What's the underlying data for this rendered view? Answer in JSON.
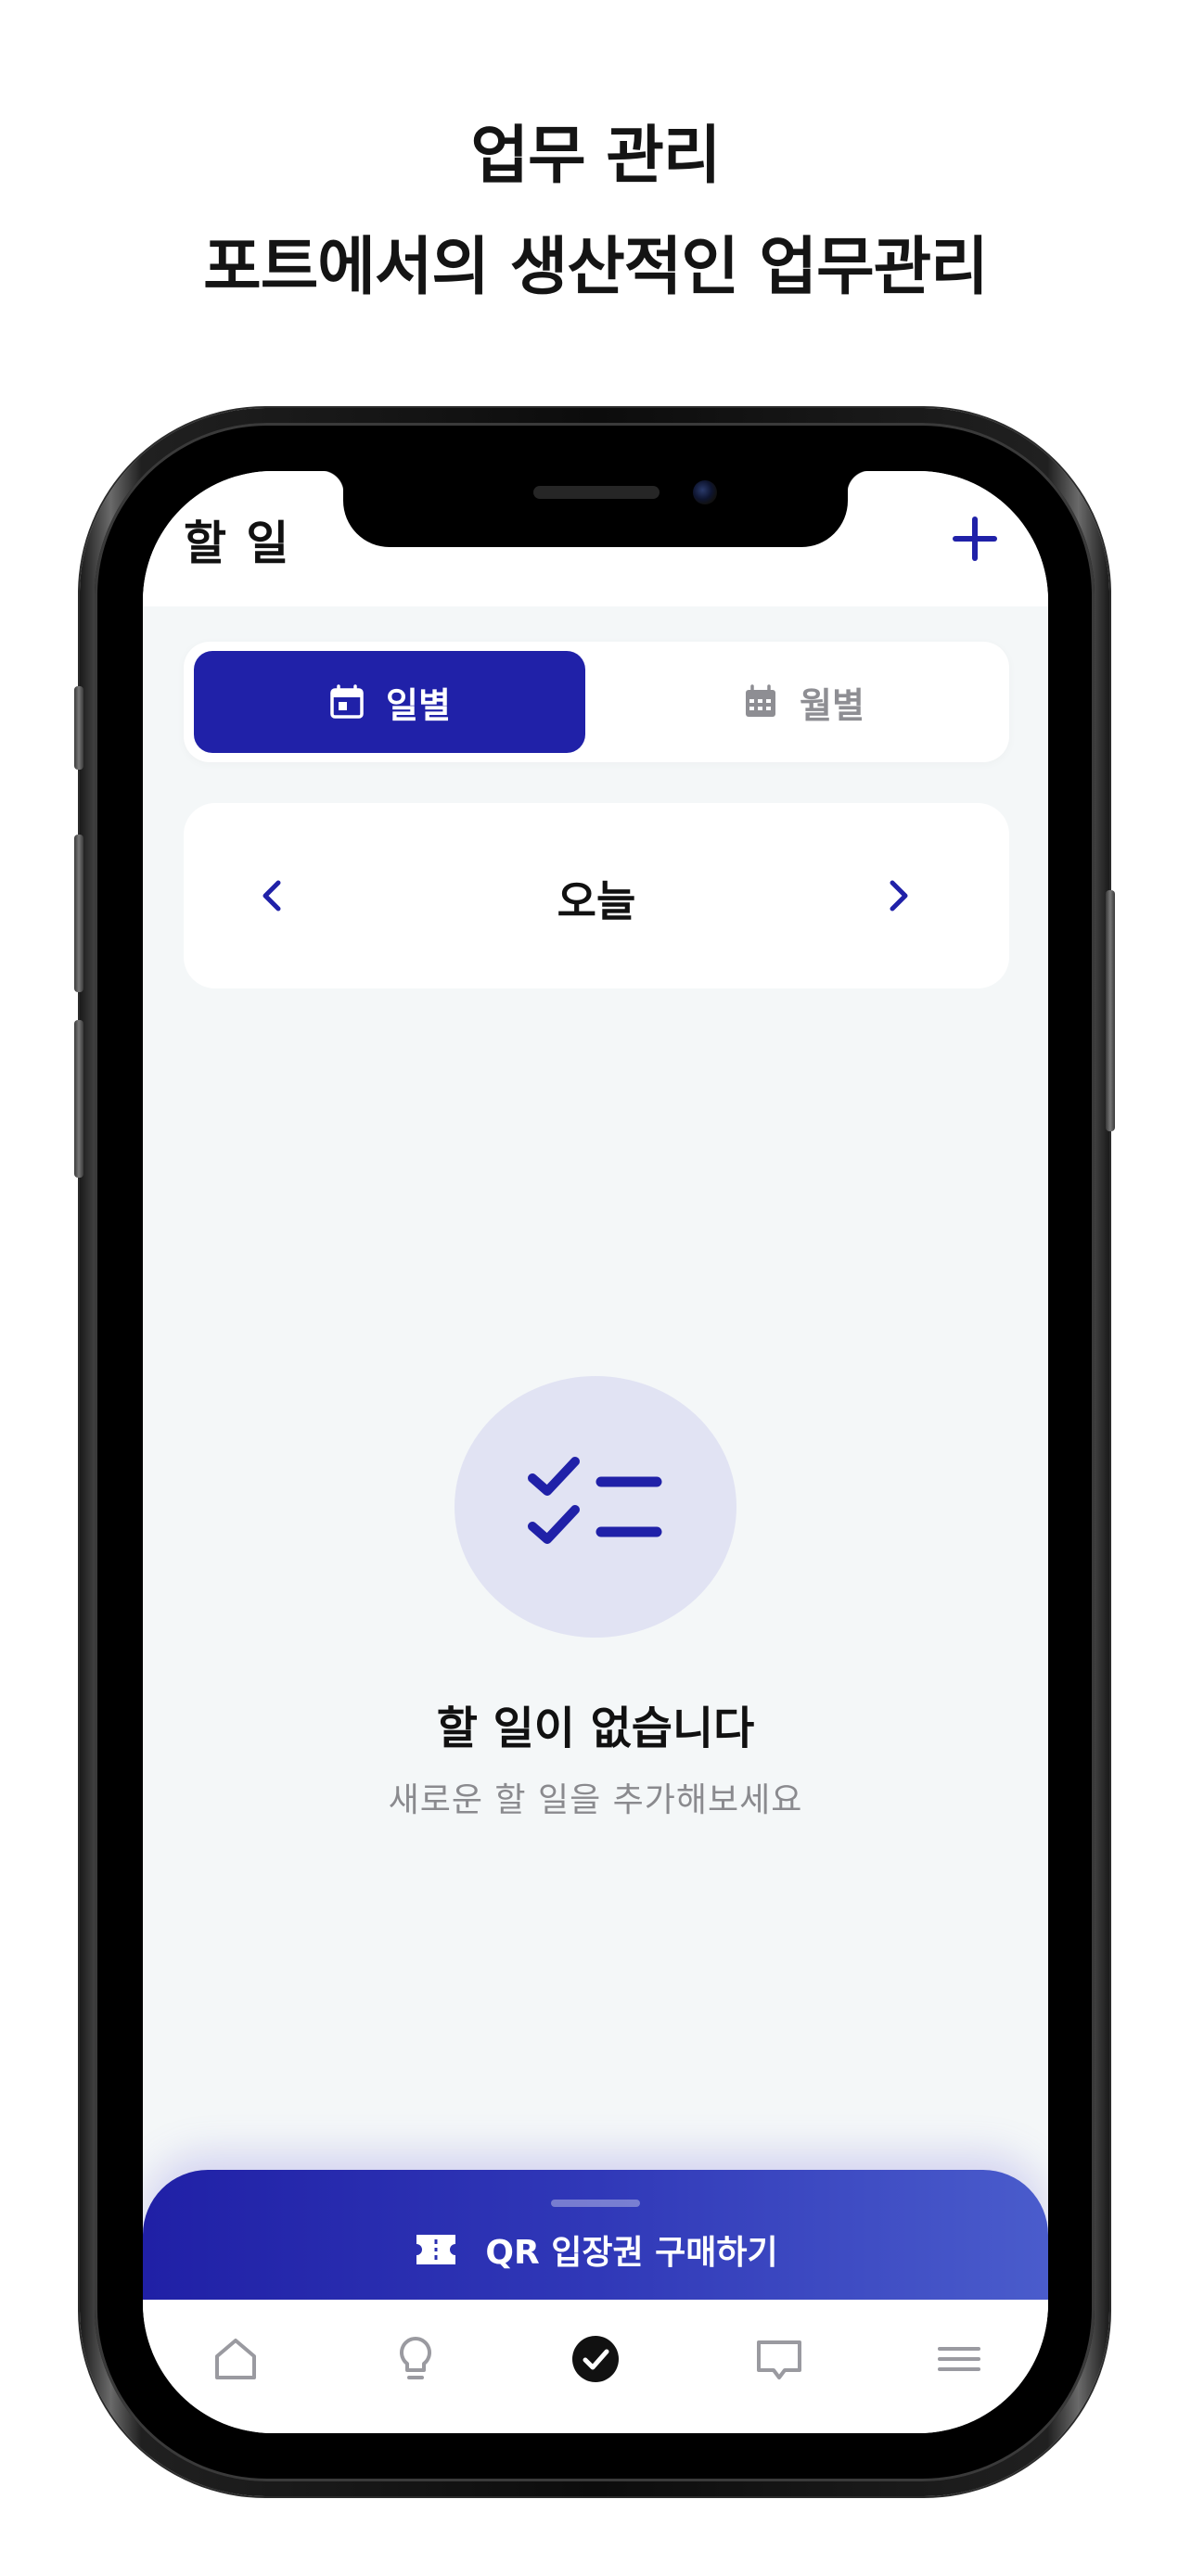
{
  "promo": {
    "headline": "업무 관리",
    "subheadline": "포트에서의 생산적인 업무관리"
  },
  "app": {
    "title": "할 일",
    "add_icon": "plus-icon",
    "accent_color": "#2021a8"
  },
  "view_toggle": {
    "daily_label": "일별",
    "monthly_label": "월별",
    "selected": "일별"
  },
  "date_nav": {
    "label": "오늘",
    "prev_icon": "chevron-left-icon",
    "next_icon": "chevron-right-icon"
  },
  "empty_state": {
    "icon": "checklist-icon",
    "title": "할 일이 없습니다",
    "subtitle": "새로운 할 일을 추가해보세요"
  },
  "qr_banner": {
    "label": "QR 입장권 구매하기",
    "icon": "ticket-icon"
  },
  "tab_bar": {
    "items": [
      {
        "name": "home-icon",
        "active": false
      },
      {
        "name": "lightbulb-icon",
        "active": false
      },
      {
        "name": "check-circle-icon",
        "active": true
      },
      {
        "name": "chat-icon",
        "active": false
      },
      {
        "name": "menu-icon",
        "active": false
      }
    ]
  }
}
